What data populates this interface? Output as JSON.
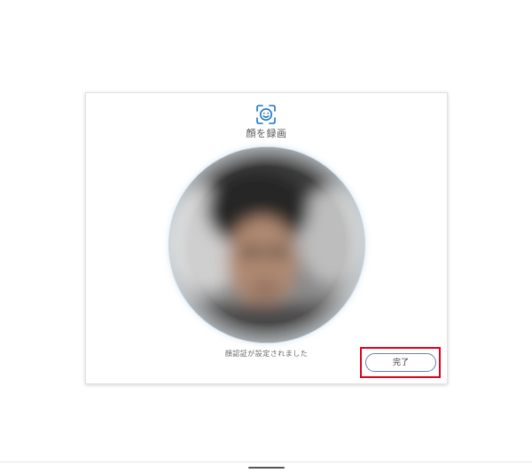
{
  "dialog": {
    "icon": "face-scan-icon",
    "title": "顔を録画",
    "status": "顔認証が設定されました",
    "done_label": "完了"
  },
  "colors": {
    "accent": "#1a73c8",
    "highlight": "#e0001b",
    "button_border": "#6b84a6"
  }
}
